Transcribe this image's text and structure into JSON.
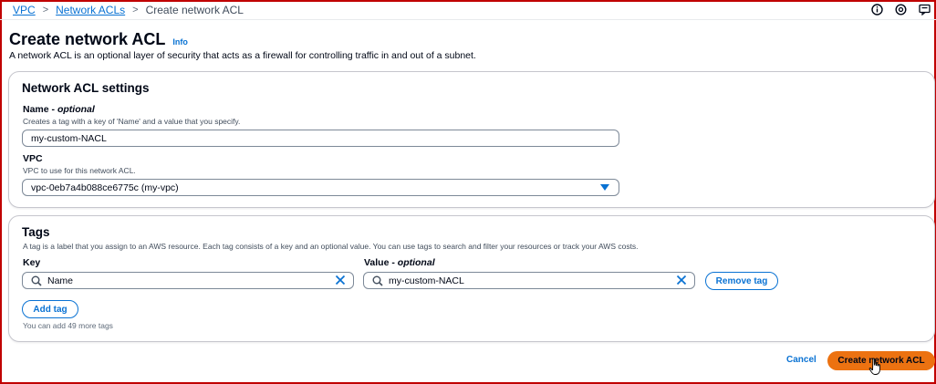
{
  "breadcrumb": {
    "items": [
      "VPC",
      "Network ACLs"
    ],
    "current": "Create network ACL"
  },
  "header": {
    "title": "Create network ACL",
    "info": "Info",
    "description": "A network ACL is an optional layer of security that acts as a firewall for controlling traffic in and out of a subnet."
  },
  "settings": {
    "title": "Network ACL settings",
    "name_label": "Name",
    "name_optional": "optional",
    "name_desc": "Creates a tag with a key of 'Name' and a value that you specify.",
    "name_value": "my-custom-NACL",
    "vpc_label": "VPC",
    "vpc_desc": "VPC to use for this network ACL.",
    "vpc_value": "vpc-0eb7a4b088ce6775c (my-vpc)"
  },
  "tags": {
    "title": "Tags",
    "description": "A tag is a label that you assign to an AWS resource. Each tag consists of a key and an optional value. You can use tags to search and filter your resources or track your AWS costs.",
    "key_label": "Key",
    "value_label": "Value",
    "value_optional": "optional",
    "key_value": "Name",
    "value_value": "my-custom-NACL",
    "remove_label": "Remove tag",
    "add_label": "Add tag",
    "hint": "You can add 49 more tags"
  },
  "footer": {
    "cancel_label": "Cancel",
    "create_label": "Create network ACL"
  },
  "icons": {
    "top": [
      "info-circle-icon",
      "settings-circle-icon",
      "feedback-icon"
    ],
    "search": "search-icon",
    "clear": "close-icon",
    "caret": "caret-down-icon"
  },
  "colors": {
    "link": "#0972d3",
    "primary": "#ec7211",
    "border": "#7d8998",
    "frame": "#c00000"
  }
}
